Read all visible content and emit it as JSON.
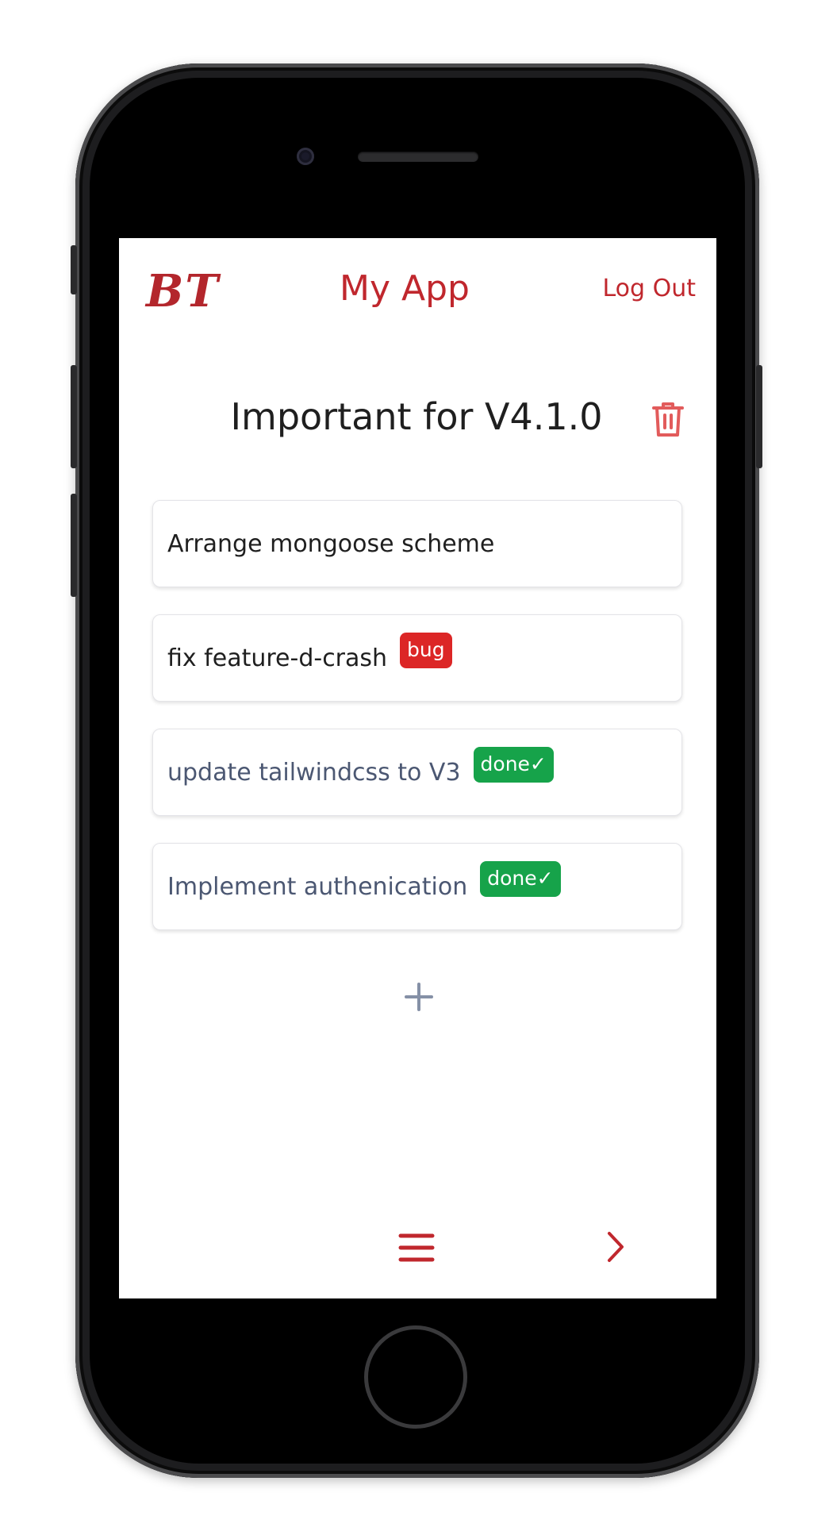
{
  "header": {
    "logo": "BT",
    "title": "My App",
    "logout_label": "Log Out"
  },
  "list": {
    "title": "Important for V4.1.0",
    "tasks": [
      {
        "text": "Arrange mongoose scheme",
        "badge": "",
        "done": false
      },
      {
        "text": "fix feature-d-crash",
        "badge": "bug",
        "done": false
      },
      {
        "text": "update tailwindcss to V3",
        "badge": "done✓",
        "done": true
      },
      {
        "text": "Implement authenication",
        "badge": "done✓",
        "done": true
      }
    ]
  },
  "icons": {
    "delete": "trash-icon",
    "add": "plus-icon",
    "menu": "hamburger-menu-icon",
    "next": "chevron-right-icon"
  },
  "colors": {
    "accent": "#c0272d",
    "bug_badge": "#dc2626",
    "done_badge": "#16a34a",
    "done_text": "#4b5772"
  }
}
